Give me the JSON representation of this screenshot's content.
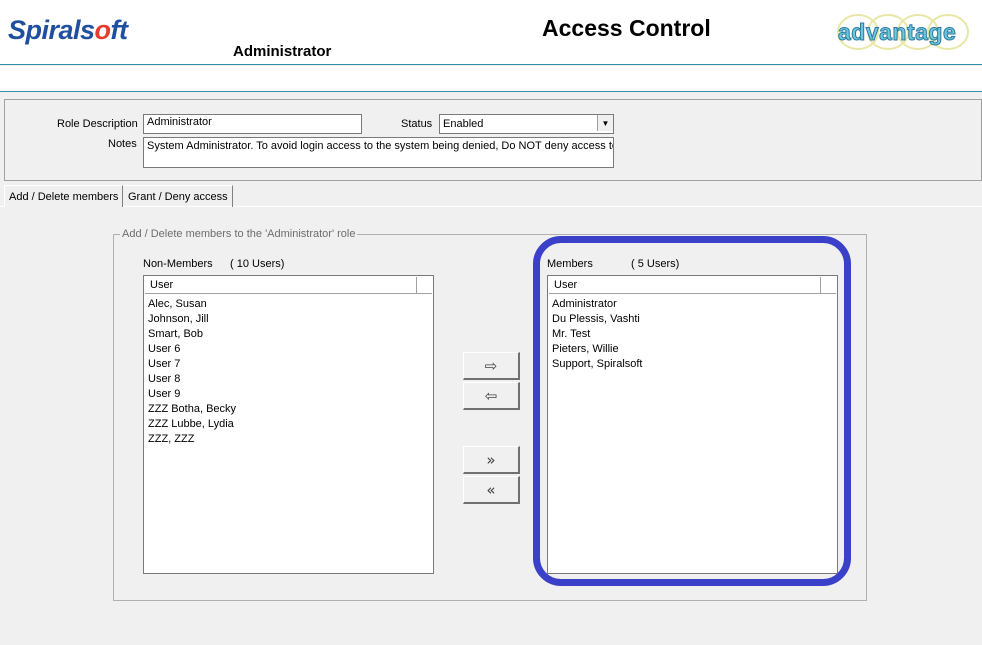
{
  "header": {
    "logo_prefix": "Spirals",
    "logo_o": "o",
    "logo_suffix": "ft",
    "title": "Access Control",
    "role_name": "Administrator",
    "brand": "advantage",
    "colors": {
      "accent": "#2f8fa8",
      "logo_blue": "#1f4f9f",
      "logo_red": "#e63b2e",
      "highlight": "#3b40c8"
    }
  },
  "role_form": {
    "description_label": "Role Description",
    "description_value": "Administrator",
    "status_label": "Status",
    "status_value": "Enabled",
    "notes_label": "Notes",
    "notes_value": "System Administrator. To avoid login access to the system being denied, Do NOT deny access to"
  },
  "tabs": [
    {
      "label": "Add / Delete members",
      "active": true
    },
    {
      "label": "Grant / Deny access",
      "active": false
    }
  ],
  "group_title": "Add / Delete members to the 'Administrator' role",
  "non_members": {
    "label": "Non-Members",
    "count": "( 10 Users)",
    "column": "User",
    "users": [
      "Alec, Susan",
      "Johnson, Jill",
      "Smart, Bob",
      "User 6",
      "User 7",
      "User 8",
      "User 9",
      "ZZZ Botha, Becky",
      "ZZZ Lubbe, Lydia",
      "ZZZ, ZZZ"
    ]
  },
  "members": {
    "label": "Members",
    "count": "( 5 Users)",
    "column": "User",
    "users": [
      "Administrator",
      "Du Plessis, Vashti",
      "Mr. Test",
      "Pieters, Willie",
      "Support, Spiralsoft"
    ]
  },
  "buttons": {
    "add_one": "⇨",
    "remove_one": "⇦",
    "add_all": "»",
    "remove_all": "«"
  }
}
